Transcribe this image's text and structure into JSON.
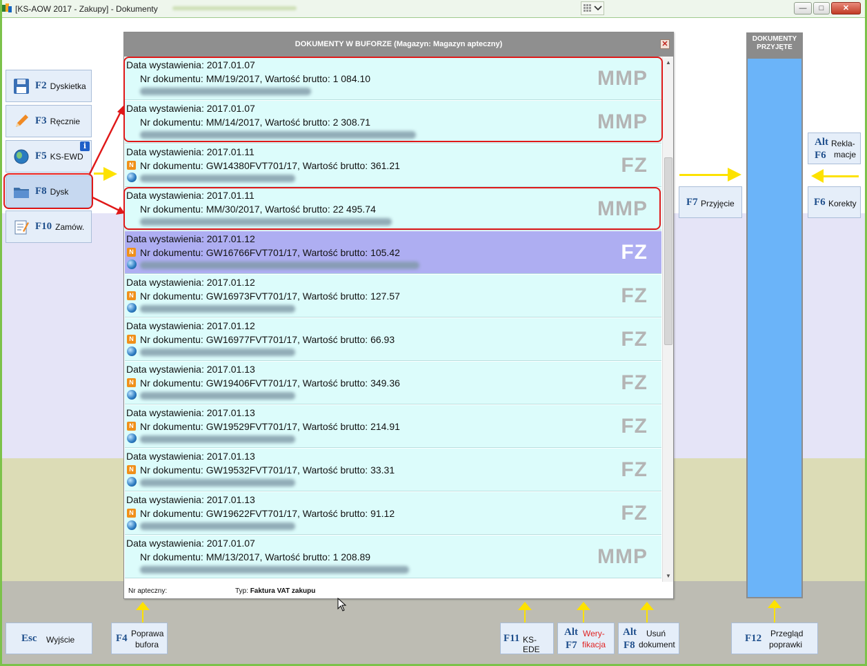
{
  "window": {
    "title": "[KS-AOW 2017 - Zakupy] - Dokumenty",
    "min_label": "—",
    "max_label": "□",
    "close_label": "✕"
  },
  "left_buttons": [
    {
      "key": "F2",
      "label": "Dyskietka",
      "icon": "floppy-disk-icon"
    },
    {
      "key": "F3",
      "label": "Ręcznie",
      "icon": "pencil-icon"
    },
    {
      "key": "F5",
      "label": "KS-EWD",
      "icon": "globe-icon",
      "badge": "i"
    },
    {
      "key": "F8",
      "label": "Dysk",
      "icon": "folder-icon"
    },
    {
      "key": "F10",
      "label": "Zamów.",
      "icon": "order-form-icon"
    }
  ],
  "dialog": {
    "title": "DOKUMENTY W BUFORZE (Magazyn: Magazyn apteczny)",
    "close_label": "✕",
    "footer_left": "Nr apteczny:",
    "footer_type_label": "Typ:",
    "footer_type_value": "Faktura VAT zakupu"
  },
  "documents": [
    {
      "date": "Data wystawienia: 2017.01.07",
      "doc": "Nr dokumentu: MM/19/2017,  Wartość brutto: 1 084.10",
      "type": "MMP",
      "badge": false
    },
    {
      "date": "Data wystawienia: 2017.01.07",
      "doc": "Nr dokumentu: MM/14/2017,  Wartość brutto: 2 308.71",
      "type": "MMP",
      "badge": false
    },
    {
      "date": "Data wystawienia: 2017.01.11",
      "doc": "Nr dokumentu: GW14380FVT701/17,  Wartość brutto: 361.21",
      "type": "FZ",
      "badge": true
    },
    {
      "date": "Data wystawienia: 2017.01.11",
      "doc": "Nr dokumentu: MM/30/2017,  Wartość brutto: 22 495.74",
      "type": "MMP",
      "badge": false
    },
    {
      "date": "Data wystawienia: 2017.01.12",
      "doc": "Nr dokumentu: GW16766FVT701/17,  Wartość brutto: 105.42",
      "type": "FZ",
      "badge": true,
      "selected": true
    },
    {
      "date": "Data wystawienia: 2017.01.12",
      "doc": "Nr dokumentu: GW16973FVT701/17,  Wartość brutto: 127.57",
      "type": "FZ",
      "badge": true
    },
    {
      "date": "Data wystawienia: 2017.01.12",
      "doc": "Nr dokumentu: GW16977FVT701/17,  Wartość brutto: 66.93",
      "type": "FZ",
      "badge": true
    },
    {
      "date": "Data wystawienia: 2017.01.13",
      "doc": "Nr dokumentu: GW19406FVT701/17,  Wartość brutto: 349.36",
      "type": "FZ",
      "badge": true
    },
    {
      "date": "Data wystawienia: 2017.01.13",
      "doc": "Nr dokumentu: GW19529FVT701/17,  Wartość brutto: 214.91",
      "type": "FZ",
      "badge": true
    },
    {
      "date": "Data wystawienia: 2017.01.13",
      "doc": "Nr dokumentu: GW19532FVT701/17,  Wartość brutto: 33.31",
      "type": "FZ",
      "badge": true
    },
    {
      "date": "Data wystawienia: 2017.01.13",
      "doc": "Nr dokumentu: GW19622FVT701/17,  Wartość brutto: 91.12",
      "type": "FZ",
      "badge": true
    },
    {
      "date": "Data wystawienia: 2017.01.07",
      "doc": "Nr dokumentu: MM/13/2017,  Wartość brutto: 1 208.89",
      "type": "MMP",
      "badge": false
    }
  ],
  "right_panel": {
    "header_line1": "DOKUMENTY",
    "header_line2": "PRZYJĘTE"
  },
  "right_buttons": {
    "reklamacje": {
      "key1": "Alt",
      "key2": "F6",
      "label1": "Rekla-",
      "label2": "macje"
    },
    "korekty": {
      "key": "F6",
      "label": "Korekty"
    },
    "przyjecie": {
      "key": "F7",
      "label": "Przyjęcie"
    }
  },
  "bottom_buttons": {
    "esc": {
      "key": "Esc",
      "label": "Wyjście"
    },
    "f4": {
      "key": "F4",
      "label1": "Poprawa",
      "label2": "bufora"
    },
    "f11": {
      "key": "F11",
      "label": "KS-EDE"
    },
    "alt_f7": {
      "key1": "Alt",
      "key2": "F7",
      "label1": "Wery-",
      "label2": "fikacja"
    },
    "alt_f8": {
      "key1": "Alt",
      "key2": "F8",
      "label1": "Usuń",
      "label2": "dokument"
    },
    "f12": {
      "key": "F12",
      "label1": "Przegląd",
      "label2": "poprawki"
    }
  },
  "colors": {
    "row_bg": "#dcfcfb",
    "row_selected": "#aeaef2",
    "highlight_red": "#e01818",
    "arrow_yellow": "#fde200",
    "right_panel_blue": "#6bb4f9"
  }
}
